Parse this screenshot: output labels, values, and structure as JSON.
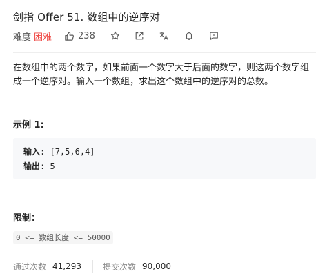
{
  "problem": {
    "title": "剑指 Offer 51. 数组中的逆序对",
    "difficulty_label": "难度",
    "difficulty": "困难",
    "likes": "238"
  },
  "icons": {
    "like": "thumbs-up-icon",
    "star": "star-icon",
    "share": "share-icon",
    "translate": "translate-icon",
    "bell": "bell-icon",
    "feedback": "feedback-icon"
  },
  "description": "在数组中的两个数字，如果前面一个数字大于后面的数字，则这两个数字组成一个逆序对。输入一个数组，求出这个数组中的逆序对的总数。",
  "example": {
    "title": "示例 1:",
    "input_label": "输入",
    "input_value": ": [7,5,6,4]",
    "output_label": "输出",
    "output_value": ": 5"
  },
  "limits": {
    "title": "限制：",
    "code": "0 <= 数组长度 <= 50000"
  },
  "stats": {
    "accepted_label": "通过次数",
    "accepted_value": "41,293",
    "submitted_label": "提交次数",
    "submitted_value": "90,000"
  },
  "colors": {
    "difficulty_hard": "#ef4743",
    "text": "#262626",
    "muted": "#8c8c8c",
    "code_bg": "#f7f8fa"
  }
}
